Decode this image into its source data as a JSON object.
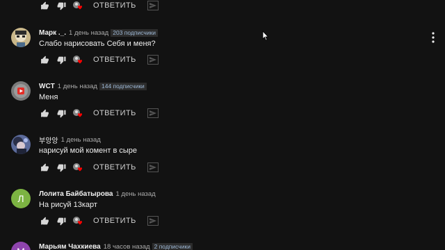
{
  "reply_label": "ОТВЕТИТЬ",
  "icons": {
    "like": "thumb-up-icon",
    "dislike": "thumb-down-icon",
    "heart": "creator-heart-icon",
    "share": "share-icon",
    "more": "more-vertical-icon",
    "cursor": "mouse-cursor-icon"
  },
  "colors": {
    "heart": "#ff0000",
    "background": "#121212"
  },
  "comments": [
    {
      "author": "Марк ._.",
      "time": "1 день назад",
      "subs": "203 подписчики",
      "text": "Слабо нарисовать Себя и меня?"
    },
    {
      "author": "WCT",
      "time": "1 день назад",
      "subs": "144 подписчики",
      "text": "Меня"
    },
    {
      "author": "부앙앙",
      "time": "1 день назад",
      "subs": "",
      "text": "нарисуй мой комент в сыре"
    },
    {
      "author": "Лолита Байбатырова",
      "time": "1 день назад",
      "subs": "",
      "avatar_letter": "Л",
      "text": "На рисуй 13карт"
    },
    {
      "author": "Марьям Чахкиева",
      "time": "18 часов назад",
      "subs": "2 подписчики",
      "avatar_letter": "М",
      "text": ""
    }
  ]
}
